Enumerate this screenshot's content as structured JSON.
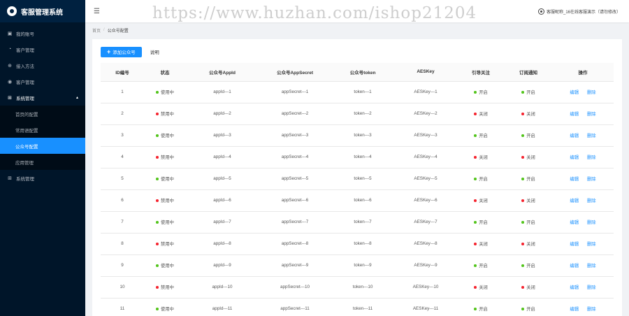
{
  "app": {
    "title": "客服管理系统"
  },
  "watermark": "https://www.huzhan.com/ishop21204",
  "header": {
    "user_text": "客服昵称_16在线客服演示（请勿修改）"
  },
  "sidebar": {
    "items": [
      {
        "label": "我的账号",
        "icon": "user-icon"
      },
      {
        "label": "客户管理",
        "icon": "customer-icon"
      },
      {
        "label": "接入方法",
        "icon": "link-icon"
      },
      {
        "label": "客户管理",
        "icon": "people-icon"
      },
      {
        "label": "系统管理",
        "icon": "grid-icon",
        "open": true
      }
    ],
    "sub_items": [
      {
        "label": "首页的配置"
      },
      {
        "label": "常用语配置"
      },
      {
        "label": "公众号配置",
        "active": true
      },
      {
        "label": "应用管理"
      }
    ],
    "last_item": {
      "label": "系统管理",
      "icon": "grid-icon"
    }
  },
  "breadcrumb": {
    "home": "首页",
    "separator": "/",
    "current": "公众号配置"
  },
  "toolbar": {
    "add_label": "添加公众号",
    "desc_label": "说明"
  },
  "table": {
    "columns": [
      "ID编号",
      "状态",
      "公众号AppId",
      "公众号AppSecret",
      "公众号token",
      "AESKey",
      "引导关注",
      "订阅通知",
      "操作"
    ],
    "rows": [
      {
        "id": "1",
        "status": "使用中",
        "status_ok": true,
        "appid": "appId---1",
        "secret": "appSecret---1",
        "token": "token---1",
        "aes": "AESKey---1",
        "guide": "开启",
        "guide_ok": true,
        "sub": "开启",
        "sub_ok": true
      },
      {
        "id": "2",
        "status": "禁用中",
        "status_ok": false,
        "appid": "appId---2",
        "secret": "appSecret---2",
        "token": "token---2",
        "aes": "AESKey---2",
        "guide": "关闭",
        "guide_ok": false,
        "sub": "关闭",
        "sub_ok": false
      },
      {
        "id": "3",
        "status": "使用中",
        "status_ok": true,
        "appid": "appId---3",
        "secret": "appSecret---3",
        "token": "token---3",
        "aes": "AESKey---3",
        "guide": "开启",
        "guide_ok": true,
        "sub": "开启",
        "sub_ok": true
      },
      {
        "id": "4",
        "status": "禁用中",
        "status_ok": false,
        "appid": "appId---4",
        "secret": "appSecret---4",
        "token": "token---4",
        "aes": "AESKey---4",
        "guide": "关闭",
        "guide_ok": false,
        "sub": "关闭",
        "sub_ok": false
      },
      {
        "id": "5",
        "status": "使用中",
        "status_ok": true,
        "appid": "appId---5",
        "secret": "appSecret---5",
        "token": "token---5",
        "aes": "AESKey---5",
        "guide": "开启",
        "guide_ok": true,
        "sub": "开启",
        "sub_ok": true
      },
      {
        "id": "6",
        "status": "禁用中",
        "status_ok": false,
        "appid": "appId---6",
        "secret": "appSecret---6",
        "token": "token---6",
        "aes": "AESKey---6",
        "guide": "关闭",
        "guide_ok": false,
        "sub": "关闭",
        "sub_ok": false
      },
      {
        "id": "7",
        "status": "使用中",
        "status_ok": true,
        "appid": "appId---7",
        "secret": "appSecret---7",
        "token": "token---7",
        "aes": "AESKey---7",
        "guide": "开启",
        "guide_ok": true,
        "sub": "开启",
        "sub_ok": true
      },
      {
        "id": "8",
        "status": "禁用中",
        "status_ok": false,
        "appid": "appId---8",
        "secret": "appSecret---8",
        "token": "token---8",
        "aes": "AESKey---8",
        "guide": "关闭",
        "guide_ok": false,
        "sub": "关闭",
        "sub_ok": false
      },
      {
        "id": "9",
        "status": "使用中",
        "status_ok": true,
        "appid": "appId---9",
        "secret": "appSecret---9",
        "token": "token---9",
        "aes": "AESKey---9",
        "guide": "开启",
        "guide_ok": true,
        "sub": "开启",
        "sub_ok": true
      },
      {
        "id": "10",
        "status": "禁用中",
        "status_ok": false,
        "appid": "appId---10",
        "secret": "appSecret---10",
        "token": "token---10",
        "aes": "AESKey---10",
        "guide": "关闭",
        "guide_ok": false,
        "sub": "关闭",
        "sub_ok": false
      },
      {
        "id": "11",
        "status": "使用中",
        "status_ok": true,
        "appid": "appId---11",
        "secret": "appSecret---11",
        "token": "token---11",
        "aes": "AESKey---11",
        "guide": "开启",
        "guide_ok": true,
        "sub": "开启",
        "sub_ok": true
      }
    ],
    "actions": {
      "edit": "编辑",
      "delete": "删除"
    }
  },
  "colors": {
    "primary": "#1890ff",
    "sidebar": "#001529",
    "on": "#52c41a",
    "off": "#f5222d"
  }
}
